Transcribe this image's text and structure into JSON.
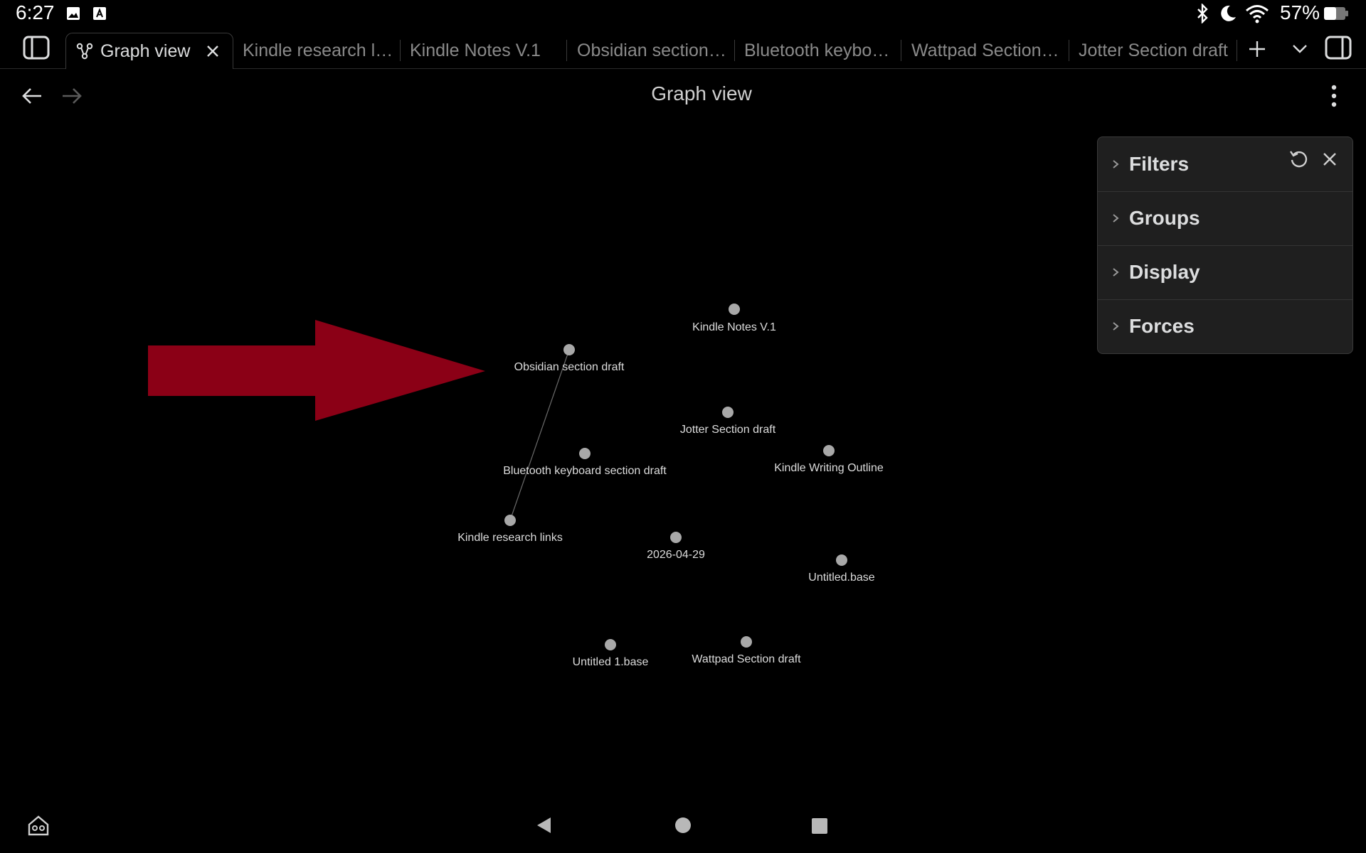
{
  "status_bar": {
    "time": "6:27",
    "battery": "57%",
    "icons": [
      "image-icon",
      "a-icon",
      "bluetooth-icon",
      "moon-icon",
      "wifi-icon",
      "battery-icon"
    ]
  },
  "tabs": [
    {
      "label": "Graph view",
      "active": true
    },
    {
      "label": "Kindle research lin...",
      "active": false
    },
    {
      "label": "Kindle Notes V.1",
      "active": false
    },
    {
      "label": "Obsidian section ...",
      "active": false
    },
    {
      "label": "Bluetooth keyboar...",
      "active": false
    },
    {
      "label": "Wattpad Section d...",
      "active": false
    },
    {
      "label": "Jotter Section draft",
      "active": false
    }
  ],
  "header": {
    "title": "Graph view"
  },
  "panel": {
    "sections": [
      "Filters",
      "Groups",
      "Display",
      "Forces"
    ]
  },
  "graph": {
    "nodes": [
      {
        "label": "Kindle Notes V.1"
      },
      {
        "label": "Obsidian section draft"
      },
      {
        "label": "Jotter Section draft"
      },
      {
        "label": "Bluetooth keyboard section draft"
      },
      {
        "label": "Kindle Writing Outline"
      },
      {
        "label": "Kindle research links"
      },
      {
        "label": "2026-04-29"
      },
      {
        "label": "Untitled.base"
      },
      {
        "label": "Untitled 1.base"
      },
      {
        "label": "Wattpad Section draft"
      }
    ],
    "links": [
      [
        "Obsidian section draft",
        "Kindle research links"
      ]
    ]
  },
  "colors": {
    "background": "#000000",
    "arrow": "#8b0016",
    "node": "#a8a8a8",
    "panel": "#1f1f1f"
  }
}
